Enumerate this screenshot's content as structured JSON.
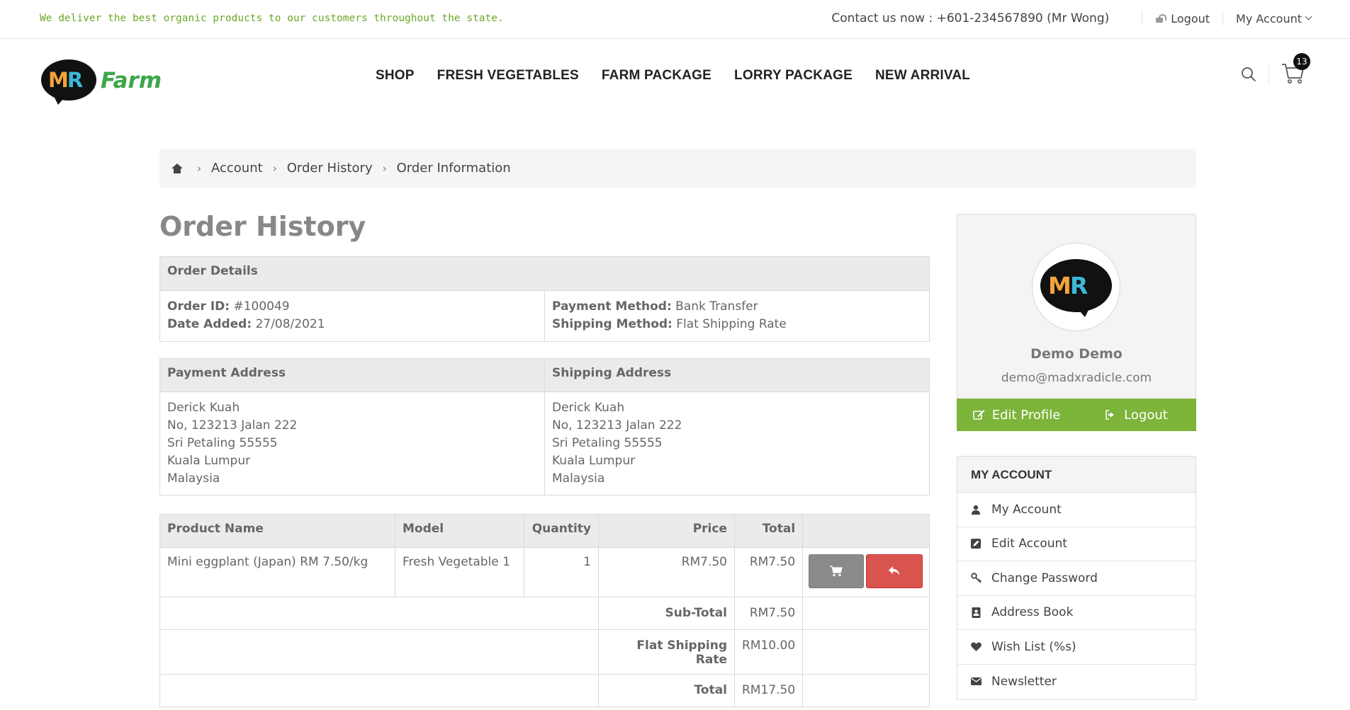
{
  "topbar": {
    "tagline": "We deliver the best organic products to our customers throughout the state.",
    "contact": "Contact us now : +601-234567890 (Mr Wong)",
    "logout": "Logout",
    "my_account": "My Account"
  },
  "brand": {
    "mark_m": "M",
    "mark_r": "R",
    "name": "Farm"
  },
  "nav": [
    "SHOP",
    "FRESH VEGETABLES",
    "FARM PACKAGE",
    "LORRY PACKAGE",
    "NEW ARRIVAL"
  ],
  "cart": {
    "count": "13"
  },
  "breadcrumb": [
    "Account",
    "Order History",
    "Order Information"
  ],
  "page_title": "Order History",
  "order_details": {
    "header": "Order Details",
    "order_id_label": "Order ID:",
    "order_id": "#100049",
    "date_label": "Date Added:",
    "date": "27/08/2021",
    "payment_method_label": "Payment Method:",
    "payment_method": "Bank Transfer",
    "shipping_method_label": "Shipping Method:",
    "shipping_method": "Flat Shipping Rate"
  },
  "addresses": {
    "payment_header": "Payment Address",
    "shipping_header": "Shipping Address",
    "payment_lines": [
      "Derick Kuah",
      "No, 123213 Jalan 222",
      "Sri Petaling 55555",
      "Kuala Lumpur",
      "Malaysia"
    ],
    "shipping_lines": [
      "Derick Kuah",
      "No, 123213 Jalan 222",
      "Sri Petaling 55555",
      "Kuala Lumpur",
      "Malaysia"
    ]
  },
  "products": {
    "headers": {
      "name": "Product Name",
      "model": "Model",
      "quantity": "Quantity",
      "price": "Price",
      "total": "Total"
    },
    "rows": [
      {
        "name": "Mini eggplant (Japan) RM 7.50/kg",
        "model": "Fresh Vegetable 1",
        "quantity": "1",
        "price": "RM7.50",
        "total": "RM7.50"
      }
    ],
    "totals": [
      {
        "label": "Sub-Total",
        "value": "RM7.50"
      },
      {
        "label": "Flat Shipping Rate",
        "value": "RM10.00"
      },
      {
        "label": "Total",
        "value": "RM17.50"
      }
    ]
  },
  "profile": {
    "name": "Demo Demo",
    "email": "demo@madxradicle.com",
    "edit_label": "Edit Profile",
    "logout_label": "Logout",
    "accent": "#7db43a"
  },
  "account_menu": {
    "header": "MY ACCOUNT",
    "items": [
      "My Account",
      "Edit Account",
      "Change Password",
      "Address Book",
      "Wish List (%s)",
      "Newsletter"
    ]
  }
}
